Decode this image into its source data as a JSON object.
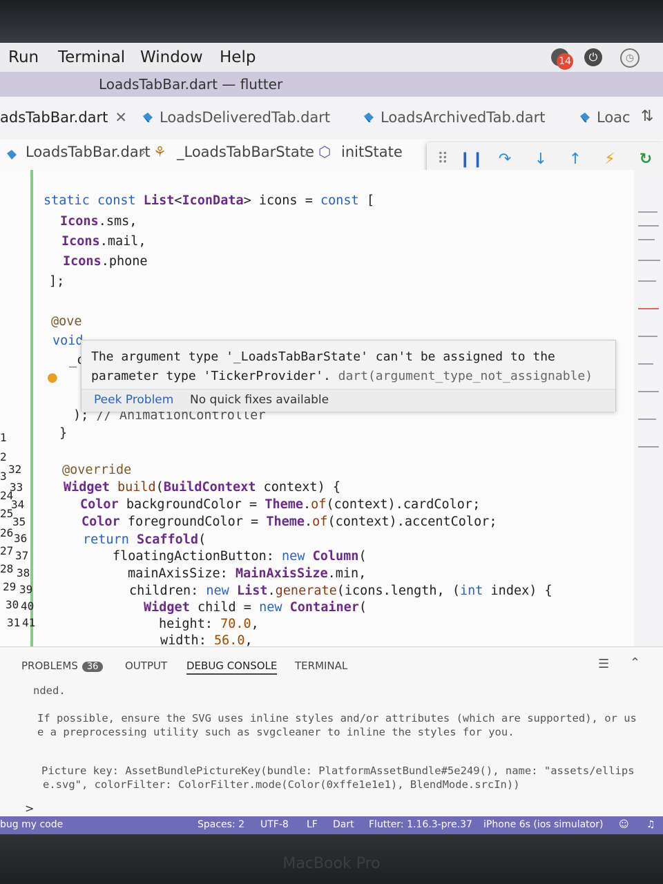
{
  "menubar": {
    "items": [
      "Run",
      "Terminal",
      "Window",
      "Help"
    ],
    "notification_count": "14"
  },
  "window": {
    "title": "LoadsTabBar.dart — flutter"
  },
  "tabs": [
    {
      "label": "adsTabBar.dart",
      "active": true
    },
    {
      "label": "LoadsDeliveredTab.dart",
      "active": false
    },
    {
      "label": "LoadsArchivedTab.dart",
      "active": false
    },
    {
      "label": "Loac",
      "active": false
    }
  ],
  "breadcrumb": [
    "LoadsTabBar.dart",
    "_LoadsTabBarState",
    "initState"
  ],
  "gutter": [
    "",
    "",
    "",
    "",
    "",
    "1",
    "2",
    "3",
    "24",
    "25",
    "26",
    "27",
    "28",
    "29",
    "30",
    "31",
    "32",
    "33",
    "34",
    "35",
    "36",
    "37",
    "38",
    "39",
    "40",
    "41"
  ],
  "hover": {
    "message_1": "The argument type '_LoadsTabBarState' can't be assigned to the",
    "message_2": "parameter type 'TickerProvider'.",
    "code": "dart(argument_type_not_assignable)",
    "peek_label": "Peek Problem",
    "no_fix_label": "No quick fixes available"
  },
  "panel": {
    "tabs": [
      "PROBLEMS",
      "OUTPUT",
      "DEBUG CONSOLE",
      "TERMINAL"
    ],
    "problems_count": "36",
    "active_tab": "DEBUG CONSOLE",
    "console": [
      "nded.",
      "If possible, ensure the SVG uses inline styles and/or attributes (which are supported), or us",
      "e a preprocessing utility such as svgcleaner to inline the styles for you.",
      "Picture key: AssetBundlePictureKey(bundle: PlatformAssetBundle#5e249(), name: \"assets/ellips",
      "e.svg\", colorFilter: ColorFilter.mode(Color(0xffe1e1e1), BlendMode.srcIn))"
    ],
    "prompt": ">"
  },
  "statusbar": {
    "left": "bug my code",
    "spaces": "Spaces: 2",
    "encoding": "UTF-8",
    "eol": "LF",
    "language": "Dart",
    "flutter": "Flutter: 1.16.3-pre.37",
    "device": "iPhone 6s (ios simulator)"
  },
  "bezel": {
    "label": "MacBook Pro"
  },
  "colors": {
    "accent": "#6e6bb8",
    "error": "#e03030",
    "keyword": "#2b62c2",
    "type": "#6a2a8a"
  }
}
